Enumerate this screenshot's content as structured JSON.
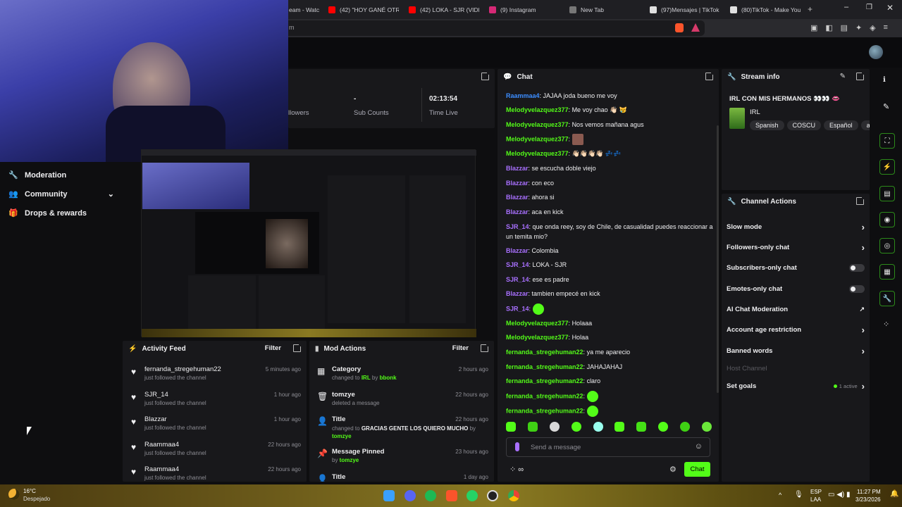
{
  "browser": {
    "tabs": [
      {
        "label": "eam - Watc",
        "color": "#53fc18"
      },
      {
        "label": "(42) \"HOY GANÉ OTRA",
        "color": "#ff0000"
      },
      {
        "label": "(42) LOKA - SJR (VIDEO",
        "color": "#ff0000"
      },
      {
        "label": "(9) Instagram",
        "color": "#d62976"
      },
      {
        "label": "New Tab",
        "color": "#888888"
      },
      {
        "label": "(97)Mensajes | TikTok",
        "color": "#e0e0e0"
      },
      {
        "label": "(80)TikTok - Make You",
        "color": "#e0e0e0"
      }
    ],
    "url": "m"
  },
  "stats": {
    "followers_label": "llowers",
    "subs_value": "-",
    "subs_label": "Sub Counts",
    "time_value": "02:13:54",
    "time_label": "Time Live"
  },
  "sidebar": {
    "items": [
      {
        "label": "Moderation",
        "icon": "wrench-icon"
      },
      {
        "label": "Community",
        "icon": "people-icon"
      },
      {
        "label": "Drops & rewards",
        "icon": "gift-icon"
      }
    ]
  },
  "chat": {
    "title": "Chat",
    "placeholder": "Send a message",
    "send_label": "Chat",
    "messages": [
      {
        "user": "Raammaa4",
        "text": "JAJAA joda bueno me voy",
        "color": "blue"
      },
      {
        "user": "Melodyvelazquez377",
        "text": "Me voy chao 👋🏻 😿",
        "color": "green"
      },
      {
        "user": "Melodyvelazquez377",
        "text": "Nos vemos mañana agus",
        "color": "green"
      },
      {
        "user": "Melodyvelazquez377",
        "text": "",
        "color": "green"
      },
      {
        "user": "Melodyvelazquez377",
        "text": "👋🏻👋🏻👋🏻👋🏻 💤💤",
        "color": "green"
      },
      {
        "user": "Blazzar",
        "text": "se escucha doble viejo",
        "color": "purple"
      },
      {
        "user": "Blazzar",
        "text": "con eco",
        "color": "purple"
      },
      {
        "user": "Blazzar",
        "text": "ahora si",
        "color": "purple"
      },
      {
        "user": "Blazzar",
        "text": "aca en kick",
        "color": "purple"
      },
      {
        "user": "SJR_14",
        "text": "que onda reey, soy de Chile, de casualidad puedes reaccionar a un temita mio?",
        "color": "purple"
      },
      {
        "user": "Blazzar",
        "text": "Colombia",
        "color": "purple"
      },
      {
        "user": "SJR_14",
        "text": "LOKA - SJR",
        "color": "purple"
      },
      {
        "user": "SJR_14",
        "text": "ese es padre",
        "color": "purple"
      },
      {
        "user": "Blazzar",
        "text": "tambien empecé en kick",
        "color": "purple"
      },
      {
        "user": "SJR_14",
        "text": "",
        "color": "purple"
      },
      {
        "user": "Melodyvelazquez377",
        "text": "Holaaa",
        "color": "green"
      },
      {
        "user": "Melodyvelazquez377",
        "text": "Holaa",
        "color": "green"
      },
      {
        "user": "fernanda_stregehuman22",
        "text": "ya me aparecio",
        "color": "green"
      },
      {
        "user": "fernanda_stregehuman22",
        "text": "JAHAJAHAJ",
        "color": "green"
      },
      {
        "user": "fernanda_stregehuman22",
        "text": "claro",
        "color": "green"
      },
      {
        "user": "fernanda_stregehuman22",
        "text": "",
        "color": "green"
      },
      {
        "user": "fernanda_stregehuman22",
        "text": "",
        "color": "green"
      }
    ]
  },
  "stream_info": {
    "title": "Stream info",
    "stream_title": "IRL CON MIS HERMANOS 👀👀 👄",
    "category": "IRL",
    "tags": [
      "Spanish",
      "COSCU",
      "Español",
      "a"
    ]
  },
  "channel_actions": {
    "title": "Channel Actions",
    "items": [
      {
        "label": "Slow mode",
        "control": "chevron"
      },
      {
        "label": "Followers-only chat",
        "control": "chevron"
      },
      {
        "label": "Subscribers-only chat",
        "control": "toggle"
      },
      {
        "label": "Emotes-only chat",
        "control": "toggle"
      },
      {
        "label": "AI Chat Moderation",
        "control": "external"
      },
      {
        "label": "Account age restriction",
        "control": "chevron"
      },
      {
        "label": "Banned words",
        "control": "chevron"
      },
      {
        "label": "Host Channel",
        "control": "none"
      },
      {
        "label": "Set goals",
        "control": "chevron",
        "badge": "1 active"
      }
    ]
  },
  "activity_feed": {
    "title": "Activity Feed",
    "filter_label": "Filter",
    "items": [
      {
        "name": "fernanda_stregehuman22",
        "sub": "just followed the channel",
        "time": "5 minutes ago"
      },
      {
        "name": "SJR_14",
        "sub": "just followed the channel",
        "time": "1 hour ago"
      },
      {
        "name": "Blazzar",
        "sub": "just followed the channel",
        "time": "1 hour ago"
      },
      {
        "name": "Raammaa4",
        "sub": "just followed the channel",
        "time": "22 hours ago"
      },
      {
        "name": "Raammaa4",
        "sub": "just followed the channel",
        "time": "22 hours ago"
      }
    ]
  },
  "mod_actions": {
    "title": "Mod Actions",
    "filter_label": "Filter",
    "items": [
      {
        "title": "Category",
        "pre": "changed to ",
        "hl": "IRL",
        "mid": " by ",
        "hl2": "bbonk",
        "time": "2 hours ago",
        "icon": "category-icon"
      },
      {
        "title": "tomzye",
        "pre": "deleted a message",
        "hl": "",
        "mid": "",
        "hl2": "",
        "time": "22 hours ago",
        "icon": "trash-icon"
      },
      {
        "title": "Title",
        "pre": "changed to ",
        "hl": "GRACIAS GENTE LOS QUIERO MUCHO",
        "mid": " by ",
        "hl2": "tomzye",
        "time": "22 hours ago",
        "icon": "person-icon"
      },
      {
        "title": "Message Pinned",
        "pre": "by ",
        "hl": "tomzye",
        "mid": "",
        "hl2": "",
        "time": "23 hours ago",
        "icon": "pin-icon"
      },
      {
        "title": "Title",
        "pre": "",
        "hl": "",
        "mid": "",
        "hl2": "",
        "time": "1 day ago",
        "icon": "person-icon"
      }
    ]
  },
  "taskbar": {
    "temp": "16°C",
    "weather": "Despejado",
    "lang": "ESP",
    "lang2": "LAA",
    "time": "11:27 PM",
    "date": "3/23/2026"
  }
}
